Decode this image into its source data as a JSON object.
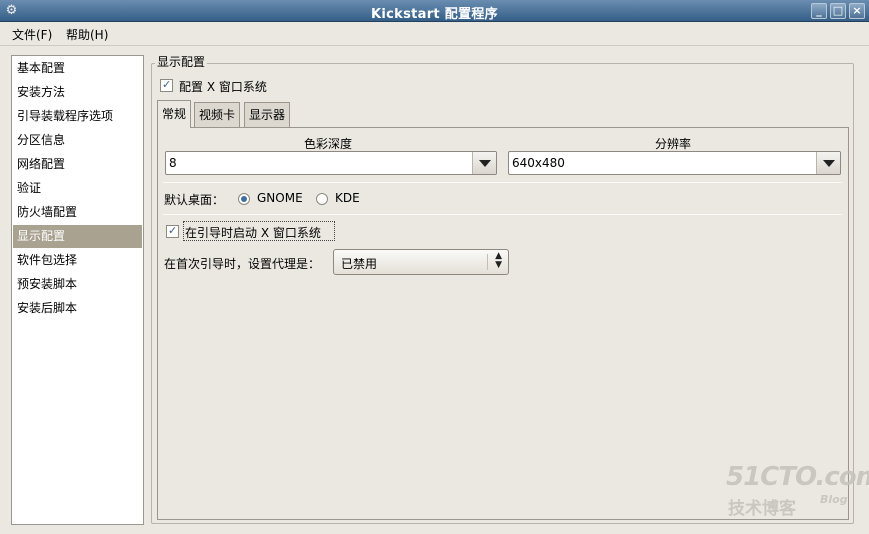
{
  "window": {
    "title": "Kickstart 配置程序",
    "buttons": {
      "minimize": "_",
      "maximize": "□",
      "close": "×"
    }
  },
  "menubar": {
    "items": [
      "文件(F)",
      "帮助(H)"
    ]
  },
  "sidebar": {
    "items": [
      {
        "label": "基本配置"
      },
      {
        "label": "安装方法"
      },
      {
        "label": "引导装载程序选项"
      },
      {
        "label": "分区信息"
      },
      {
        "label": "网络配置"
      },
      {
        "label": "验证"
      },
      {
        "label": "防火墙配置"
      },
      {
        "label": "显示配置",
        "selected": true
      },
      {
        "label": "软件包选择"
      },
      {
        "label": "预安装脚本"
      },
      {
        "label": "安装后脚本"
      }
    ]
  },
  "main": {
    "section_title": "显示配置",
    "configure_x_label": "配置 X 窗口系统",
    "configure_x_checked": true,
    "tabs": [
      {
        "label": "常规",
        "active": true
      },
      {
        "label": "视频卡"
      },
      {
        "label": "显示器"
      }
    ],
    "general": {
      "color_depth_label": "色彩深度",
      "color_depth_value": "8",
      "resolution_label": "分辨率",
      "resolution_value": "640x480",
      "default_desktop_label": "默认桌面：",
      "desktop_options": [
        {
          "label": "GNOME",
          "selected": true
        },
        {
          "label": "KDE",
          "selected": false
        }
      ],
      "start_x_label": "在引导时启动 X 窗口系统",
      "start_x_checked": true,
      "firstboot_label": "在首次引导时，设置代理是：",
      "firstboot_value": "已禁用"
    }
  },
  "watermark": {
    "main": "51CTO.com",
    "sub": "技术博客",
    "blog": "Blog"
  },
  "colors": {
    "titlebar": "#355f88",
    "selection": "#a9a291",
    "background": "#ebe8e2"
  }
}
